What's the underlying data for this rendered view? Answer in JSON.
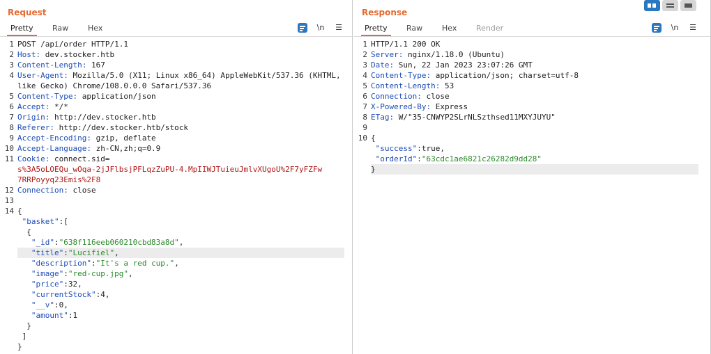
{
  "request": {
    "title": "Request",
    "tabs": [
      "Pretty",
      "Raw",
      "Hex"
    ],
    "newline_icon_label": "\\n",
    "line_numbers": [
      "1",
      "2",
      "3",
      "4",
      "",
      "5",
      "6",
      "7",
      "8",
      "9",
      "10",
      "11",
      "",
      "",
      "12",
      "13",
      "14",
      "",
      "",
      "",
      "",
      "",
      "",
      "",
      "",
      "",
      "",
      "",
      "",
      ""
    ],
    "lines": [
      {
        "plain": "POST /api/order HTTP/1.1"
      },
      {
        "key": "Host:",
        "val": " dev.stocker.htb"
      },
      {
        "key": "Content-Length:",
        "val": " 167"
      },
      {
        "key": "User-Agent:",
        "val": " Mozilla/5.0 (X11; Linux x86_64) AppleWebKit/537.36 (KHTML,"
      },
      {
        "plain": "like Gecko) Chrome/108.0.0.0 Safari/537.36"
      },
      {
        "key": "Content-Type:",
        "val": " application/json"
      },
      {
        "key": "Accept:",
        "val": " */*"
      },
      {
        "key": "Origin:",
        "val": " http://dev.stocker.htb"
      },
      {
        "key": "Referer:",
        "val": " http://dev.stocker.htb/stock"
      },
      {
        "key": "Accept-Encoding:",
        "val": " gzip, deflate"
      },
      {
        "key": "Accept-Language:",
        "val": " zh-CN,zh;q=0.9"
      },
      {
        "key": "Cookie:",
        "val": " connect.sid="
      },
      {
        "cookie": "s%3A5oLOEQu_wOqa-2jJFlbsjPFLqzZuPU-4.MpIIWJTuieuJmlvXUgoU%2F7yFZFw"
      },
      {
        "cookie": "7RRPoyyq23Emis%2F8"
      },
      {
        "key": "Connection:",
        "val": " close"
      },
      {
        "plain": ""
      },
      {
        "plain": "{"
      },
      {
        "jkey": " \"basket\"",
        "rest": ":["
      },
      {
        "plain": "  {"
      },
      {
        "jkey": "   \"_id\"",
        "rest": ":",
        "str": "\"638f116eeb060210cbd83a8d\"",
        "tail": ","
      },
      {
        "jkey": "   \"title\"",
        "rest": ":",
        "str": "\"Lucifiel\"",
        "tail": ","
      },
      {
        "jkey": "   \"description\"",
        "rest": ":",
        "str": "\"It's a red cup.\"",
        "tail": ","
      },
      {
        "jkey": "   \"image\"",
        "rest": ":",
        "str": "\"red-cup.jpg\"",
        "tail": ","
      },
      {
        "jkey": "   \"price\"",
        "rest": ":32,"
      },
      {
        "jkey": "   \"currentStock\"",
        "rest": ":4,"
      },
      {
        "jkey": "   \"__v\"",
        "rest": ":0,"
      },
      {
        "jkey": "   \"amount\"",
        "rest": ":1"
      },
      {
        "plain": "  }"
      },
      {
        "plain": " ]"
      },
      {
        "plain": "}"
      }
    ]
  },
  "response": {
    "title": "Response",
    "tabs": [
      "Pretty",
      "Raw",
      "Hex",
      "Render"
    ],
    "newline_icon_label": "\\n",
    "line_numbers": [
      "1",
      "2",
      "3",
      "4",
      "5",
      "6",
      "7",
      "8",
      "9",
      "10",
      "",
      "",
      ""
    ],
    "lines": [
      {
        "plain": "HTTP/1.1 200 OK"
      },
      {
        "key": "Server:",
        "val": " nginx/1.18.0 (Ubuntu)"
      },
      {
        "key": "Date:",
        "val": " Sun, 22 Jan 2023 23:07:26 GMT"
      },
      {
        "key": "Content-Type:",
        "val": " application/json; charset=utf-8"
      },
      {
        "key": "Content-Length:",
        "val": " 53"
      },
      {
        "key": "Connection:",
        "val": " close"
      },
      {
        "key": "X-Powered-By:",
        "val": " Express"
      },
      {
        "key": "ETag:",
        "val": " W/\"35-CNWYP2SLrNLSzthsed11MXYJUYU\""
      },
      {
        "plain": ""
      },
      {
        "plain": "{"
      },
      {
        "jkey": " \"success\"",
        "rest": ":true,"
      },
      {
        "jkey": " \"orderId\"",
        "rest": ":",
        "str": "\"63cdc1ae6821c26282d9dd28\""
      },
      {
        "plain": "}"
      }
    ]
  },
  "colors": {
    "accent": "#e56a30",
    "header_key": "#1f4eb6",
    "string": "#2b8a2b",
    "cookie": "#b01818",
    "active_button": "#2b78c2"
  }
}
